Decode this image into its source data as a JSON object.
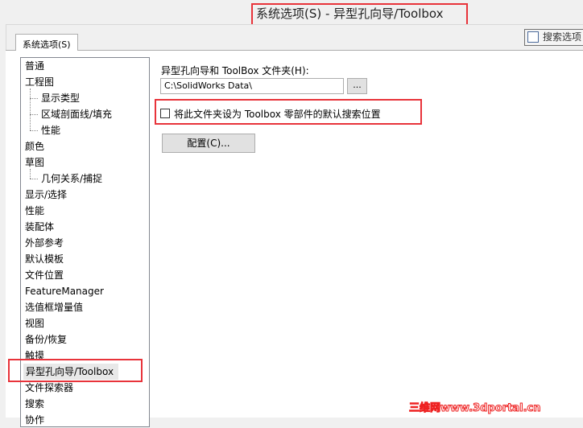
{
  "window": {
    "title": "系统选项(S) - 异型孔向导/Toolbox"
  },
  "tab": {
    "label": "系统选项(S)"
  },
  "search": {
    "label": "搜索选项"
  },
  "tree": [
    {
      "label": "普通",
      "level": 0
    },
    {
      "label": "工程图",
      "level": 0
    },
    {
      "label": "显示类型",
      "level": 1
    },
    {
      "label": "区域剖面线/填充",
      "level": 1
    },
    {
      "label": "性能",
      "level": 1
    },
    {
      "label": "颜色",
      "level": 0
    },
    {
      "label": "草图",
      "level": 0
    },
    {
      "label": "几何关系/捕捉",
      "level": 1
    },
    {
      "label": "显示/选择",
      "level": 0
    },
    {
      "label": "性能",
      "level": 0
    },
    {
      "label": "装配体",
      "level": 0
    },
    {
      "label": "外部参考",
      "level": 0
    },
    {
      "label": "默认模板",
      "level": 0
    },
    {
      "label": "文件位置",
      "level": 0
    },
    {
      "label": "FeatureManager",
      "level": 0
    },
    {
      "label": "选值框增量值",
      "level": 0
    },
    {
      "label": "视图",
      "level": 0
    },
    {
      "label": "备份/恢复",
      "level": 0
    },
    {
      "label": "触摸",
      "level": 0
    },
    {
      "label": "异型孔向导/Toolbox",
      "level": 0,
      "selected": true
    },
    {
      "label": "文件探索器",
      "level": 0
    },
    {
      "label": "搜索",
      "level": 0
    },
    {
      "label": "协作",
      "level": 0
    }
  ],
  "main": {
    "folder_label": "异型孔向导和 ToolBox 文件夹(H):",
    "folder_value": "C:\\SolidWorks Data\\",
    "browse_label": "...",
    "checkbox_label": "将此文件夹设为 Toolbox 零部件的默认搜索位置",
    "checkbox_checked": false,
    "configure_label": "配置(C)..."
  },
  "watermark": "三维网www.3dportal.cn"
}
